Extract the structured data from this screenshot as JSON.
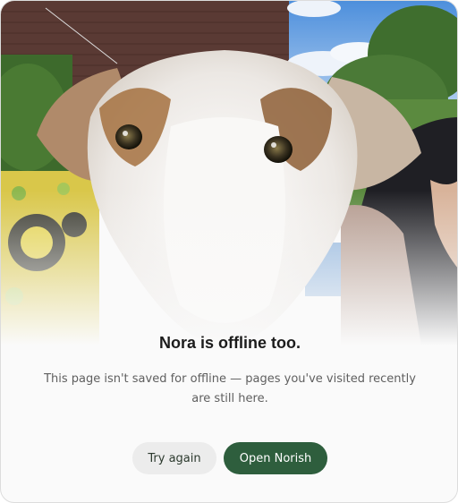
{
  "offline": {
    "title": "Nora is offline too.",
    "message": "This page isn't saved for offline — pages you've visited recently are still here."
  },
  "actions": {
    "retry_label": "Try again",
    "open_label": "Open Norish"
  },
  "colors": {
    "primary_button": "#2e5e3d",
    "secondary_button": "#ececec",
    "title_text": "#1c1c1c",
    "body_text": "#5f5f5f"
  },
  "hero": {
    "subject": "borzoi dog close-up photo"
  }
}
